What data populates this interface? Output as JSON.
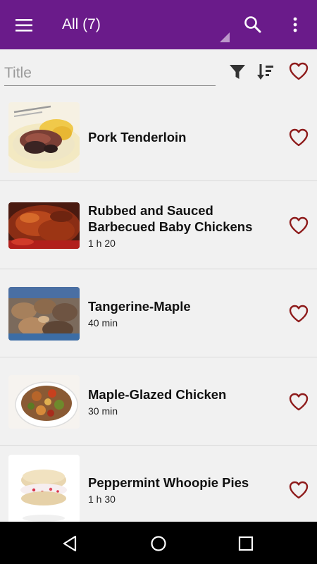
{
  "app_bar": {
    "title": "All (7)",
    "background": "#6a1b8a",
    "icons": [
      "menu-icon",
      "search-icon",
      "more-vert-icon"
    ]
  },
  "search": {
    "placeholder": "Title",
    "value": ""
  },
  "toolbar_icons": [
    "filter-icon",
    "sort-icon",
    "favorite-icon"
  ],
  "recipes": [
    {
      "title": "Pork Tenderloin",
      "time": ""
    },
    {
      "title": "Rubbed and Sauced Barbecued Baby Chickens",
      "time": "1 h 20"
    },
    {
      "title": "Tangerine-Maple",
      "time": "40 min"
    },
    {
      "title": "Maple-Glazed Chicken",
      "time": "30 min"
    },
    {
      "title": "Peppermint Whoopie Pies",
      "time": "1 h 30"
    }
  ],
  "accent_color": "#8e1b1b",
  "nav_bar": {
    "icons": [
      "back-icon",
      "home-icon",
      "recents-icon"
    ]
  }
}
